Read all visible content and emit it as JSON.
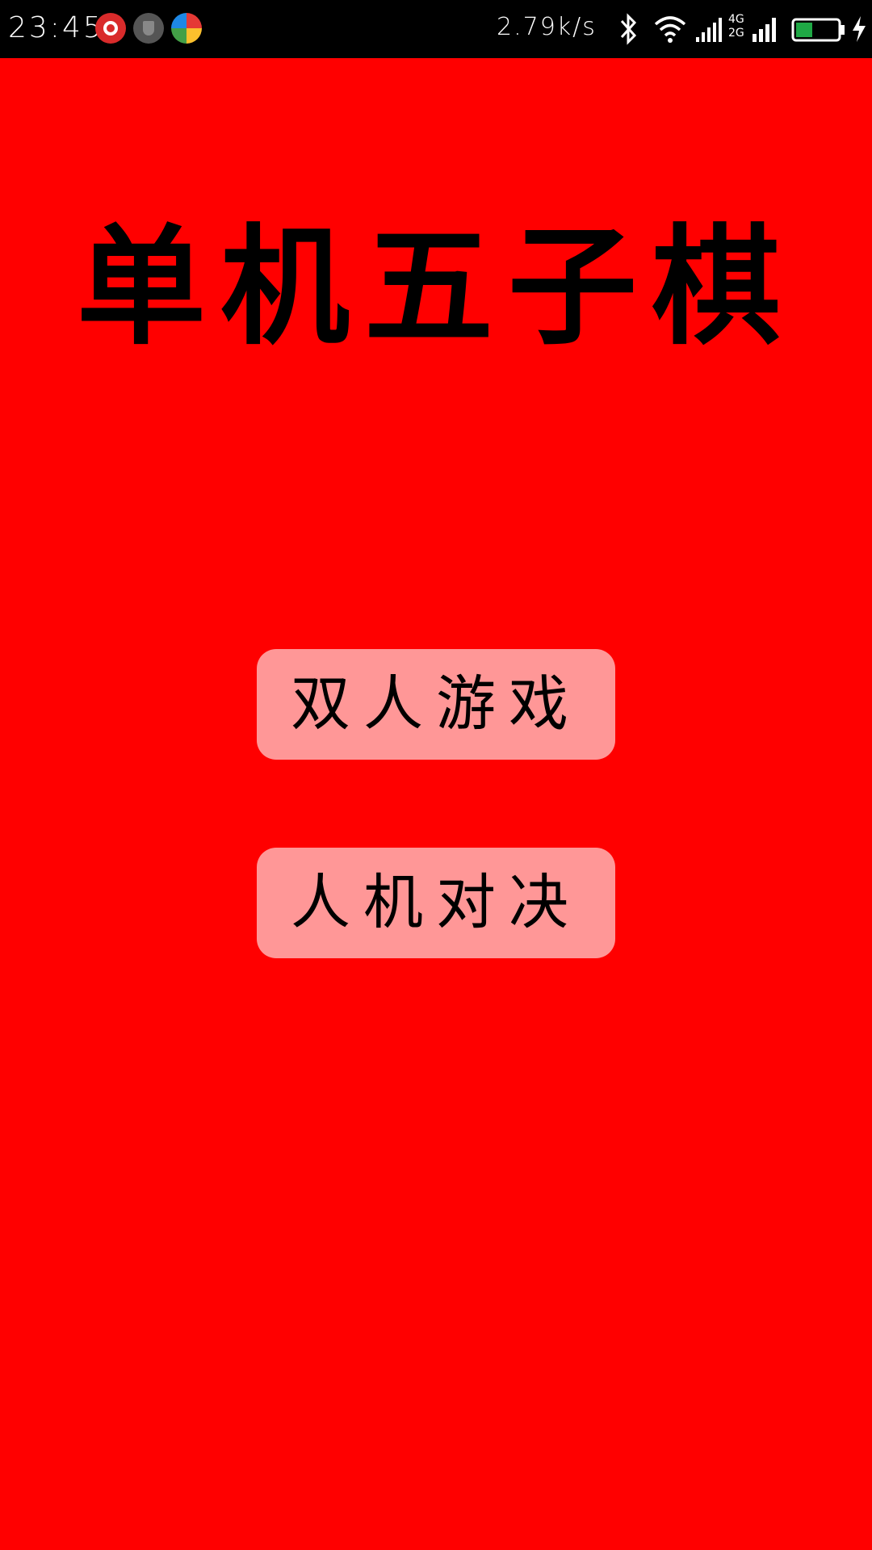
{
  "status_bar": {
    "time": "23:45",
    "net_speed": "2.79k/s",
    "net_types": [
      "4G",
      "2G"
    ],
    "notification_icons": [
      "music-app-icon",
      "shield-icon",
      "chart-app-icon"
    ],
    "system_icons": [
      "bluetooth-icon",
      "wifi-icon",
      "signal-icon",
      "battery-icon",
      "charging-icon"
    ],
    "colors": {
      "background": "#000000",
      "text": "#ffffff",
      "battery_fill": "#1fa845"
    },
    "battery_level": 0.4
  },
  "main": {
    "title": "单机五子棋",
    "buttons": {
      "two_player": "双人游戏",
      "vs_ai": "人机对决"
    },
    "colors": {
      "background": "#ff0000",
      "button": "#ff9797",
      "text": "#000000"
    }
  }
}
